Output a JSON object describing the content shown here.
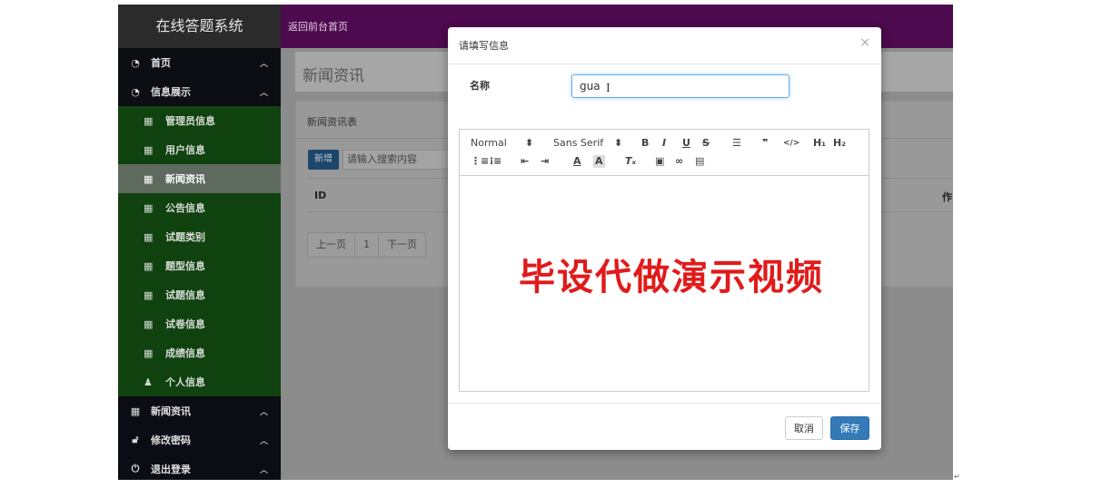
{
  "sidebar": {
    "brand": "在线答题系统",
    "top_items": [
      {
        "label": "首页",
        "icon": "dashboard-icon"
      },
      {
        "label": "信息展示",
        "icon": "dashboard-icon"
      }
    ],
    "sub_items": [
      {
        "label": "管理员信息",
        "icon": "table-icon"
      },
      {
        "label": "用户信息",
        "icon": "table-icon"
      },
      {
        "label": "新闻资讯",
        "icon": "table-icon",
        "active": true
      },
      {
        "label": "公告信息",
        "icon": "table-icon"
      },
      {
        "label": "试题类别",
        "icon": "table-icon"
      },
      {
        "label": "题型信息",
        "icon": "table-icon"
      },
      {
        "label": "试题信息",
        "icon": "table-icon"
      },
      {
        "label": "试卷信息",
        "icon": "table-icon"
      },
      {
        "label": "成绩信息",
        "icon": "table-icon"
      },
      {
        "label": "个人信息",
        "icon": "user-icon"
      }
    ],
    "bottom_items": [
      {
        "label": "新闻资讯",
        "icon": "table-icon"
      },
      {
        "label": "修改密码",
        "icon": "lock-icon"
      },
      {
        "label": "退出登录",
        "icon": "power-icon"
      }
    ]
  },
  "topbar": {
    "back_link": "返回前台首页"
  },
  "main": {
    "page_title": "新闻资讯",
    "panel_title": "新闻资讯表",
    "add_button": "新增",
    "search_value": "请输入搜索内容",
    "table": {
      "col_id": "ID",
      "col_last": "作"
    },
    "pager": {
      "prev": "上一页",
      "page": "1",
      "next": "下一页"
    }
  },
  "modal": {
    "title": "请填写信息",
    "close": "×",
    "name_label": "名称",
    "name_value": "gua",
    "toolbar": {
      "header_select": "Normal",
      "font_select": "Sans Serif",
      "icons": [
        "bold-icon",
        "italic-icon",
        "underline-icon",
        "strike-icon",
        "align-icon",
        "blockquote-icon",
        "code-icon",
        "h1-icon",
        "h2-icon",
        "ordered-list-icon",
        "bullet-list-icon",
        "outdent-icon",
        "indent-icon",
        "font-color-icon",
        "background-color-icon",
        "clean-format-icon",
        "image-icon",
        "link-icon",
        "video-icon"
      ]
    },
    "watermark": "毕设代做演示视频",
    "cancel_button": "取消",
    "save_button": "保存"
  }
}
